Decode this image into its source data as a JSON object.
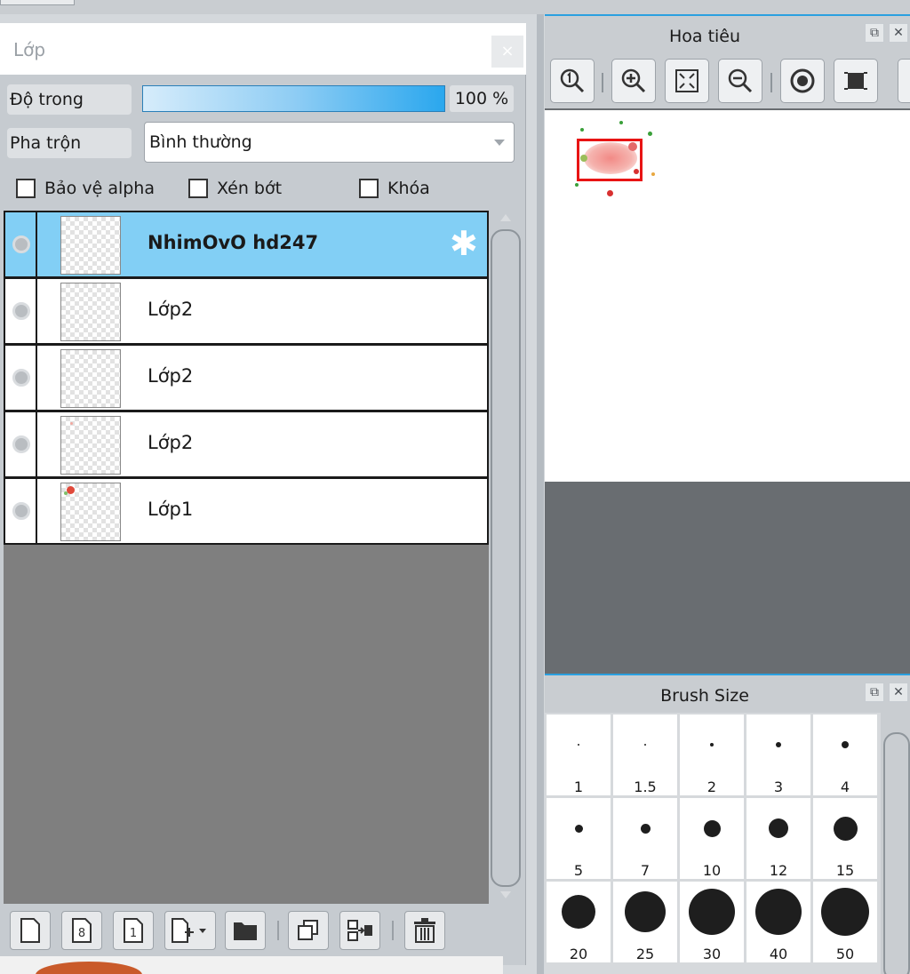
{
  "layer_panel": {
    "title": "Lớp",
    "close_label": "×",
    "opacity_label": "Độ trong",
    "opacity_value": "100 %",
    "opacity_fraction": 1.0,
    "blend_label": "Pha trộn",
    "blend_value": "Bình thường",
    "checkboxes": [
      {
        "label": "Bảo vệ alpha",
        "checked": false
      },
      {
        "label": "Xén bớt",
        "checked": false
      },
      {
        "label": "Khóa",
        "checked": false
      }
    ],
    "layers": [
      {
        "name": "NhimOvO hd247",
        "selected": true
      },
      {
        "name": "Lớp2",
        "selected": false
      },
      {
        "name": "Lớp2",
        "selected": false
      },
      {
        "name": "Lớp2",
        "selected": false
      },
      {
        "name": "Lớp1",
        "selected": false
      }
    ],
    "toolbar": {
      "new_layer_icon": "new-layer-icon",
      "new_8bit_label": "8",
      "new_1bit_label": "1",
      "add_special_icon": "add-layer-menu-icon",
      "folder_icon": "folder-icon",
      "duplicate_icon": "duplicate-icon",
      "merge_icon": "merge-down-icon",
      "delete_icon": "trash-icon"
    }
  },
  "navigator": {
    "title": "Hoa tiêu",
    "tools": [
      "zoom-actual-icon",
      "zoom-in-icon",
      "fit-screen-icon",
      "zoom-out-icon",
      "rotate-icon",
      "flip-icon"
    ]
  },
  "brush_size": {
    "title": "Brush Size",
    "sizes": [
      "1",
      "1.5",
      "2",
      "3",
      "4",
      "5",
      "7",
      "10",
      "12",
      "15",
      "20",
      "25",
      "30",
      "40",
      "50"
    ]
  },
  "colors": {
    "accent": "#2aa0e0",
    "selected_row": "#82cff5",
    "nav_frame": "#e81414"
  }
}
